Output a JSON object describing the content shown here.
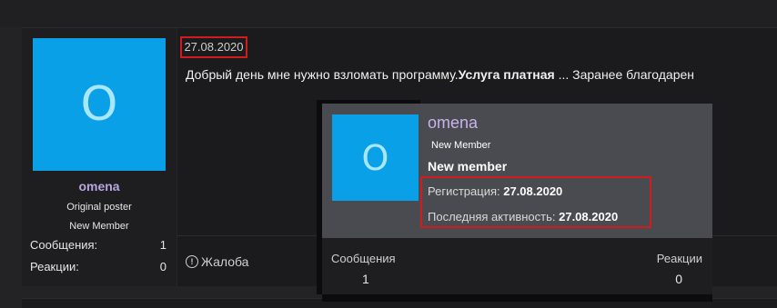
{
  "post": {
    "date": "27.08.2020",
    "text_before": "Добрый день мне нужно взломать программу.",
    "text_bold": "Услуга платная",
    "text_after": " ... Заранее благодарен",
    "report_label": "Жалоба"
  },
  "user": {
    "avatar_letter": "O",
    "name": "omena",
    "role": "Original poster",
    "rank": "New Member",
    "stats": [
      {
        "label": "Сообщения:",
        "value": "1"
      },
      {
        "label": "Реакции:",
        "value": "0"
      }
    ]
  },
  "card": {
    "avatar_letter": "O",
    "name": "omena",
    "badge": "New Member",
    "title": "New member",
    "registration_label": "Регистрация: ",
    "registration_value": "27.08.2020",
    "activity_label": "Последняя активность: ",
    "activity_value": "27.08.2020",
    "messages_label": "Сообщения",
    "messages_value": "1",
    "reactions_label": "Реакции",
    "reactions_value": "0"
  },
  "colors": {
    "accent_avatar": "#0aa0e8",
    "username": "#b9a6de",
    "highlight_box": "#d01c1c"
  }
}
